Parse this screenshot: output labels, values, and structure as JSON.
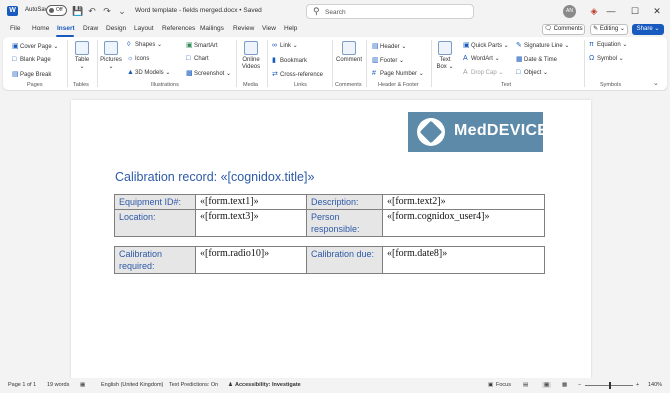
{
  "titlebar": {
    "app_logo": "W",
    "autosave_label": "AutoSave",
    "autosave_state": "Off",
    "doc_title": "Word template - fields merged.docx • Saved",
    "search_placeholder": "Search",
    "avatar_initials": "AN",
    "icons": [
      "save-icon",
      "undo-icon",
      "redo-icon",
      "customize-icon",
      "search-icon",
      "sparkle-icon",
      "minimize-icon",
      "maximize-icon",
      "close-icon"
    ]
  },
  "menu": {
    "tabs": [
      "File",
      "Home",
      "Insert",
      "Draw",
      "Design",
      "Layout",
      "References",
      "Mailings",
      "Review",
      "View",
      "Help"
    ],
    "active_tab": "Insert",
    "comments_label": "Comments",
    "editing_label": "Editing",
    "share_label": "Share"
  },
  "ribbon": {
    "pages": {
      "cover_page": "Cover Page",
      "blank_page": "Blank Page",
      "page_break": "Page Break",
      "group": "Pages"
    },
    "tables": {
      "table": "Table",
      "group": "Tables"
    },
    "illustrations": {
      "pictures": "Pictures",
      "shapes": "Shapes",
      "icons": "Icons",
      "models_3d": "3D Models",
      "smartart": "SmartArt",
      "chart": "Chart",
      "screenshot": "Screenshot",
      "group": "Illustrations"
    },
    "media": {
      "online_videos": "Online Videos",
      "group": "Media"
    },
    "links": {
      "link": "Link",
      "bookmark": "Bookmark",
      "cross_reference": "Cross-reference",
      "group": "Links"
    },
    "comments": {
      "comment": "Comment",
      "group": "Comments"
    },
    "header_footer": {
      "header": "Header",
      "footer": "Footer",
      "page_number": "Page Number",
      "group": "Header & Footer"
    },
    "text": {
      "text_box": "Text Box",
      "quick_parts": "Quick Parts",
      "wordart": "WordArt",
      "drop_cap": "Drop Cap",
      "signature_line": "Signature Line",
      "date_time": "Date & Time",
      "object": "Object",
      "group": "Text"
    },
    "symbols": {
      "equation": "Equation",
      "symbol": "Symbol",
      "group": "Symbols"
    }
  },
  "document": {
    "logo_text": "MedDEVICE",
    "heading": "Calibration record: «[cognidox.title]»",
    "table1": [
      [
        "Equipment ID#:",
        "«[form.text1]»",
        "Description:",
        "«[form.text2]»"
      ],
      [
        "Location:",
        "«[form.text3]»",
        "Person responsible:",
        "«[form.cognidox_user4]»"
      ]
    ],
    "table2": [
      [
        "Calibration required:",
        "«[form.radio10]»",
        "Calibration due:",
        "«[form.date8]»"
      ]
    ]
  },
  "statusbar": {
    "page": "Page 1 of 1",
    "words": "19 words",
    "language": "English (United Kingdom)",
    "text_predictions": "Text Predictions: On",
    "accessibility": "Accessibility: Investigate",
    "focus": "Focus",
    "zoom": "140%"
  },
  "colors": {
    "brand": "#185abd",
    "label_blue": "#2e5aa8",
    "label_bg": "#e6e6e6",
    "logo_bg": "#5d8aa8"
  }
}
